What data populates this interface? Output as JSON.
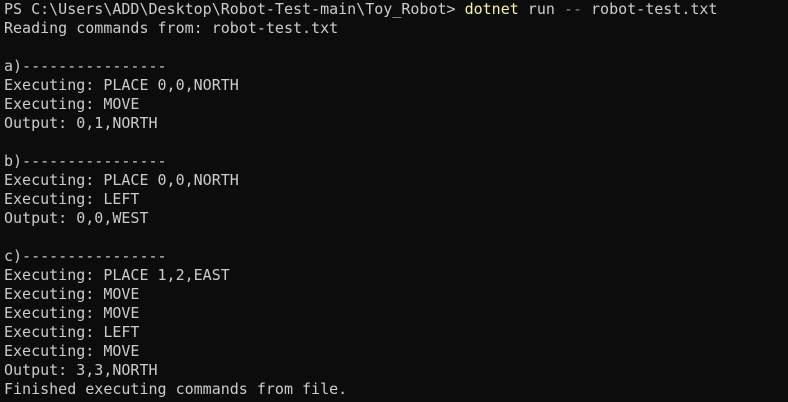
{
  "prompt": {
    "path": "PS C:\\Users\\ADD\\Desktop\\Robot-Test-main\\Toy_Robot> ",
    "command": "dotnet",
    "arg_run": " run ",
    "flag": "--",
    "arg_file": " robot-test.txt"
  },
  "reading_line": "Reading commands from: robot-test.txt",
  "sections": [
    {
      "header": "a)----------------",
      "lines": [
        "Executing: PLACE 0,0,NORTH",
        "Executing: MOVE"
      ],
      "output": "Output: 0,1,NORTH"
    },
    {
      "header": "b)----------------",
      "lines": [
        "Executing: PLACE 0,0,NORTH",
        "Executing: LEFT"
      ],
      "output": "Output: 0,0,WEST"
    },
    {
      "header": "c)----------------",
      "lines": [
        "Executing: PLACE 1,2,EAST",
        "Executing: MOVE",
        "Executing: MOVE",
        "Executing: LEFT",
        "Executing: MOVE"
      ],
      "output": "Output: 3,3,NORTH"
    }
  ],
  "finished_line": "Finished executing commands from file.",
  "colors": {
    "background": "#0c0c0c",
    "text": "#cccccc",
    "command": "#f9f1a5",
    "flag": "#8a8a8a"
  }
}
